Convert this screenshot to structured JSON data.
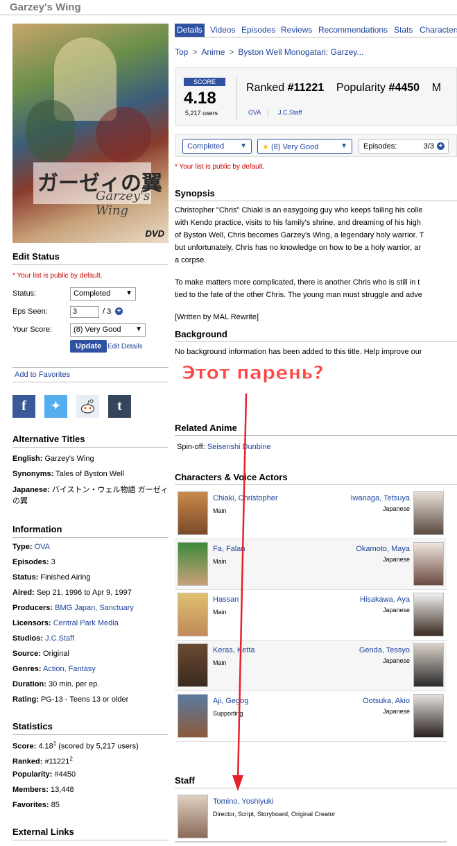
{
  "page": {
    "title": "Garzey's Wing"
  },
  "left": {
    "edit_status": {
      "heading": "Edit Status",
      "note": "* Your list is public by default.",
      "status_label": "Status:",
      "status_value": "Completed",
      "eps_label": "Eps Seen:",
      "eps_value": "3",
      "eps_total": "/ 3",
      "score_label": "Your Score:",
      "score_value": "(8) Very Good",
      "update_label": "Update",
      "edit_details_label": "Edit Details"
    },
    "add_favorites": "Add to Favorites",
    "social": [
      "f",
      "t",
      "r",
      "t"
    ],
    "alt_titles": {
      "heading": "Alternative Titles",
      "rows": [
        {
          "label": "English:",
          "value": "Garzey's Wing"
        },
        {
          "label": "Synonyms:",
          "value": "Tales of Byston Well"
        },
        {
          "label": "Japanese:",
          "value": "バイストン・ウェル物語 ガーゼィの翼"
        }
      ]
    },
    "information": {
      "heading": "Information",
      "rows": [
        {
          "label": "Type:",
          "value": "OVA",
          "link": true
        },
        {
          "label": "Episodes:",
          "value": "3"
        },
        {
          "label": "Status:",
          "value": "Finished Airing"
        },
        {
          "label": "Aired:",
          "value": "Sep 21, 1996 to Apr 9, 1997"
        },
        {
          "label": "Producers:",
          "value": "BMG Japan, Sanctuary",
          "link": true
        },
        {
          "label": "Licensors:",
          "value": "Central Park Media",
          "link": true
        },
        {
          "label": "Studios:",
          "value": "J.C.Staff",
          "link": true
        },
        {
          "label": "Source:",
          "value": "Original"
        },
        {
          "label": "Genres:",
          "value": "Action, Fantasy",
          "link": true
        },
        {
          "label": "Duration:",
          "value": "30 min. per ep."
        },
        {
          "label": "Rating:",
          "value": "PG-13 - Teens 13 or older"
        }
      ]
    },
    "statistics": {
      "heading": "Statistics",
      "score_label": "Score:",
      "score_value": "4.18",
      "score_sup": "1",
      "score_note": "(scored by 5,217 users)",
      "ranked_label": "Ranked:",
      "ranked_value": "#11221",
      "ranked_sup": "2",
      "popularity_label": "Popularity:",
      "popularity_value": "#4450",
      "members_label": "Members:",
      "members_value": "13,448",
      "favorites_label": "Favorites:",
      "favorites_value": "85"
    },
    "external_links_heading": "External Links"
  },
  "tabs": [
    "Details",
    "Videos",
    "Episodes",
    "Reviews",
    "Recommendations",
    "Stats",
    "Characters"
  ],
  "breadcrumb": {
    "items": [
      "Top",
      "Anime",
      "Byston Well Monogatari: Garzey..."
    ],
    "sep": ">"
  },
  "scorebox": {
    "badge": "SCORE",
    "score": "4.18",
    "users": "5,217 users",
    "ranked_label": "Ranked",
    "ranked_value": "#11221",
    "popularity_label": "Popularity",
    "popularity_value": "#4450",
    "cut_letter": "M",
    "type": "OVA",
    "studio": "J.C.Staff"
  },
  "userbar": {
    "status": "Completed",
    "score": "(8) Very Good",
    "episodes_label": "Episodes:",
    "episodes_value": "3/3",
    "note": "* Your list is public by default."
  },
  "synopsis": {
    "heading": "Synopsis",
    "lines": [
      "Christopher \"Chris\" Chiaki is an easygoing guy who keeps failing his colle",
      "with Kendo practice, visits to his family's shrine, and dreaming of his high",
      "of Byston Well, Chris becomes Garzey's Wing, a legendary holy warrior. T",
      "but unfortunately, Chris has no knowledge on how to be a holy warrior, ar",
      "a corpse.",
      "",
      "To make matters more complicated, there is another Chris who is still in t",
      "tied to the fate of the other Chris. The young man must struggle and adve",
      "",
      "[Written by MAL Rewrite]"
    ]
  },
  "background": {
    "heading": "Background",
    "text": "No background information has been added to this title. Help improve our"
  },
  "overlay_text": "Этот парень?",
  "related": {
    "heading": "Related Anime",
    "label": "Spin-off:",
    "value": "Seisenshi Dunbine"
  },
  "characters": {
    "heading": "Characters & Voice Actors",
    "rows": [
      {
        "name": "Chiaki, Christopher",
        "role": "Main",
        "va": "Iwanaga, Tetsuya",
        "lang": "Japanese"
      },
      {
        "name": "Fa, Falan",
        "role": "Main",
        "va": "Okamoto, Maya",
        "lang": "Japanese"
      },
      {
        "name": "Hassan",
        "role": "Main",
        "va": "Hisakawa, Aya",
        "lang": "Japanese"
      },
      {
        "name": "Keras, Ketta",
        "role": "Main",
        "va": "Genda, Tessyo",
        "lang": "Japanese"
      },
      {
        "name": "Aji, Gegog",
        "role": "Supporting",
        "va": "Ootsuka, Akio",
        "lang": "Japanese"
      }
    ]
  },
  "staff": {
    "heading": "Staff",
    "name": "Tomino, Yoshiyuki",
    "role": "Director, Script, Storyboard, Original Creator"
  },
  "colors": {
    "accent": "#2e51a2",
    "link": "#1d439b",
    "overlay": "#ff4444",
    "arrow": "#e8202a"
  }
}
